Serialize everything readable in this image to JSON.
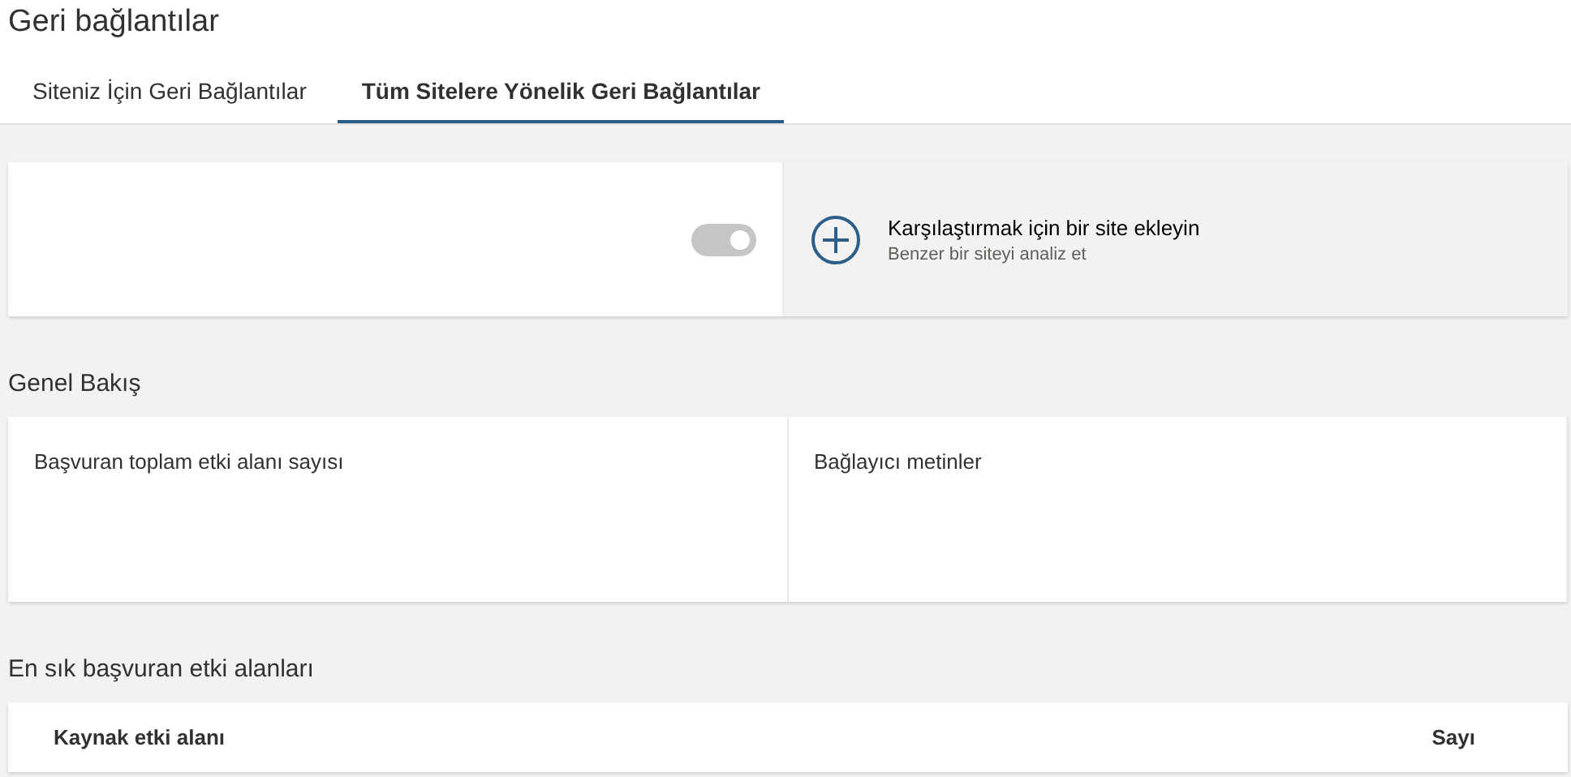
{
  "page_title": "Geri bağlantılar",
  "tabs": [
    {
      "label": "Siteniz İçin Geri Bağlantılar",
      "selected": false
    },
    {
      "label": "Tüm Sitelere Yönelik Geri Bağlantılar",
      "selected": true
    }
  ],
  "compare": {
    "toggle": {
      "on": true,
      "disabled": true
    },
    "add_title": "Karşılaştırmak için bir site ekleyin",
    "add_subtitle": "Benzer bir siteyi analiz et"
  },
  "overview": {
    "heading": "Genel Bakış",
    "cards": [
      "Başvuran toplam etki alanı sayısı",
      "Bağlayıcı metinler"
    ]
  },
  "top_domains": {
    "heading": "En sık başvuran etki alanları",
    "columns": [
      "Kaynak etki alanı",
      "Sayı"
    ]
  }
}
